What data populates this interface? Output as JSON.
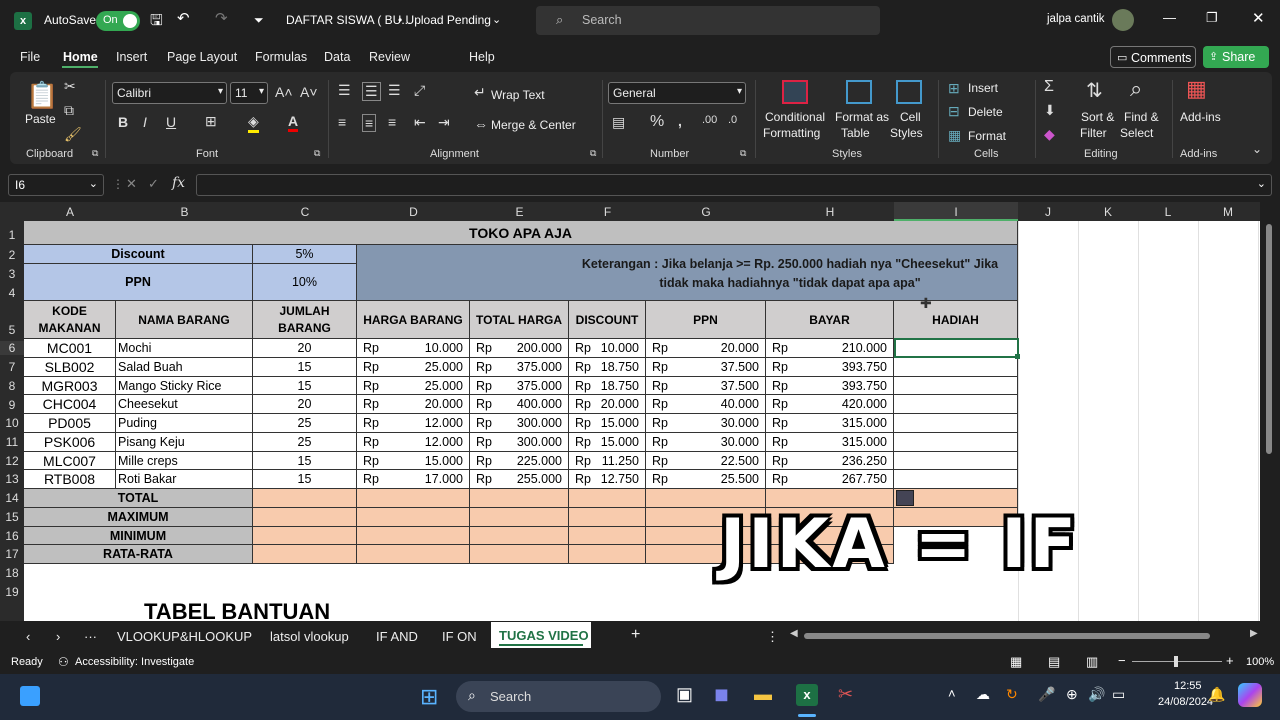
{
  "titlebar": {
    "autosave_label": "AutoSave",
    "autosave_state": "On",
    "doc_title": "DAFTAR SISWA ( BU...",
    "upload_status": "• Upload Pending",
    "search_placeholder": "Search",
    "user_name": "jalpa cantik"
  },
  "menu": [
    "File",
    "Home",
    "Insert",
    "Page Layout",
    "Formulas",
    "Data",
    "Review",
    "Help"
  ],
  "menu_right": {
    "comments": "Comments",
    "share": "Share"
  },
  "ribbon": {
    "clipboard": {
      "paste": "Paste",
      "group": "Clipboard"
    },
    "font": {
      "name": "Calibri",
      "size": "11",
      "group": "Font"
    },
    "alignment": {
      "wrap": "Wrap Text",
      "merge": "Merge & Center",
      "group": "Alignment"
    },
    "number": {
      "format": "General",
      "group": "Number"
    },
    "styles": {
      "cond1": "Conditional",
      "cond2": "Formatting",
      "fmt1": "Format as",
      "fmt2": "Table",
      "cell1": "Cell",
      "cell2": "Styles",
      "group": "Styles"
    },
    "cells": {
      "insert": "Insert",
      "delete": "Delete",
      "format": "Format",
      "group": "Cells"
    },
    "editing": {
      "sort1": "Sort &",
      "sort2": "Filter",
      "find1": "Find &",
      "find2": "Select",
      "group": "Editing"
    },
    "addins": {
      "label": "Add-ins",
      "group": "Add-ins"
    }
  },
  "formula_bar": {
    "cell_ref": "I6",
    "formula": ""
  },
  "columns": [
    "A",
    "B",
    "C",
    "D",
    "E",
    "F",
    "G",
    "H",
    "I",
    "J",
    "K",
    "L",
    "M"
  ],
  "rows": [
    "1",
    "2",
    "3",
    "4",
    "5",
    "6",
    "7",
    "8",
    "9",
    "10",
    "11",
    "12",
    "13",
    "14",
    "15",
    "16",
    "17",
    "18",
    "19"
  ],
  "sheet": {
    "title": "TOKO APA AJA",
    "discount_label": "Discount",
    "discount_value": "5%",
    "ppn_label": "PPN",
    "ppn_value": "10%",
    "note": "Keterangan : Jika belanja >= Rp. 250.000 hadiah nya \"Cheesekut\" Jika tidak maka hadiahnya  \"tidak dapat apa apa\"",
    "headers": {
      "kode": "KODE MAKANAN",
      "nama": "NAMA BARANG",
      "jumlah": "JUMLAH BARANG",
      "harga": "HARGA BARANG",
      "total": "TOTAL HARGA",
      "discount": "DISCOUNT",
      "ppn": "PPN",
      "bayar": "BAYAR",
      "hadiah": "HADIAH"
    },
    "currency": "Rp",
    "items": [
      {
        "kode": "MC001",
        "nama": "Mochi",
        "jumlah": "20",
        "harga": "10.000",
        "total": "200.000",
        "discount": "10.000",
        "ppn": "20.000",
        "bayar": "210.000"
      },
      {
        "kode": "SLB002",
        "nama": "Salad Buah",
        "jumlah": "15",
        "harga": "25.000",
        "total": "375.000",
        "discount": "18.750",
        "ppn": "37.500",
        "bayar": "393.750"
      },
      {
        "kode": "MGR003",
        "nama": "Mango Sticky Rice",
        "jumlah": "15",
        "harga": "25.000",
        "total": "375.000",
        "discount": "18.750",
        "ppn": "37.500",
        "bayar": "393.750"
      },
      {
        "kode": "CHC004",
        "nama": "Cheesekut",
        "jumlah": "20",
        "harga": "20.000",
        "total": "400.000",
        "discount": "20.000",
        "ppn": "40.000",
        "bayar": "420.000"
      },
      {
        "kode": "PD005",
        "nama": "Puding",
        "jumlah": "25",
        "harga": "12.000",
        "total": "300.000",
        "discount": "15.000",
        "ppn": "30.000",
        "bayar": "315.000"
      },
      {
        "kode": "PSK006",
        "nama": "Pisang Keju",
        "jumlah": "25",
        "harga": "12.000",
        "total": "300.000",
        "discount": "15.000",
        "ppn": "30.000",
        "bayar": "315.000"
      },
      {
        "kode": "MLC007",
        "nama": "Mille creps",
        "jumlah": "15",
        "harga": "15.000",
        "total": "225.000",
        "discount": "11.250",
        "ppn": "22.500",
        "bayar": "236.250"
      },
      {
        "kode": "RTB008",
        "nama": "Roti Bakar",
        "jumlah": "15",
        "harga": "17.000",
        "total": "255.000",
        "discount": "12.750",
        "ppn": "25.500",
        "bayar": "267.750"
      }
    ],
    "summary": [
      "TOTAL",
      "MAXIMUM",
      "MINIMUM",
      "RATA-RATA"
    ],
    "tabel_bantuan": "TABEL BANTUAN"
  },
  "overlay_text": "JIKA = IF",
  "tabs": [
    "VLOOKUP&HLOOKUP",
    "latsol vlookup",
    "IF AND",
    "IF ON",
    "TUGAS VIDEO"
  ],
  "active_tab": "TUGAS VIDEO",
  "status": {
    "ready": "Ready",
    "accessibility": "Accessibility: Investigate",
    "zoom": "100%"
  },
  "taskbar": {
    "search": "Search",
    "time": "12:55",
    "date": "24/08/2024"
  }
}
